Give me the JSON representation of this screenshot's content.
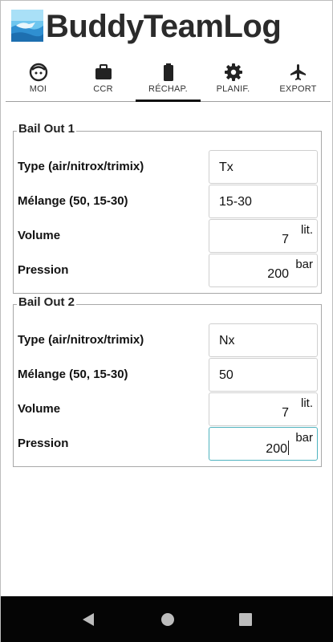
{
  "app": {
    "title": "BuddyTeamLog"
  },
  "tabs": [
    {
      "label": "MOI",
      "icon": "face-icon"
    },
    {
      "label": "CCR",
      "icon": "briefcase-icon"
    },
    {
      "label": "RÉCHAP.",
      "icon": "battery-icon",
      "active": true
    },
    {
      "label": "PLANIF.",
      "icon": "gear-icon"
    },
    {
      "label": "EXPORT",
      "icon": "airplane-icon"
    }
  ],
  "bailouts": [
    {
      "title": "Bail Out 1",
      "type_label": "Type (air/nitrox/trimix)",
      "type_value": "Tx",
      "mix_label": "Mélange (50, 15-30)",
      "mix_value": "15-30",
      "volume_label": "Volume",
      "volume_value": "7",
      "volume_unit": "lit.",
      "pressure_label": "Pression",
      "pressure_value": "200",
      "pressure_unit": "bar"
    },
    {
      "title": "Bail Out 2",
      "type_label": "Type (air/nitrox/trimix)",
      "type_value": "Nx",
      "mix_label": "Mélange (50, 15-30)",
      "mix_value": "50",
      "volume_label": "Volume",
      "volume_value": "7",
      "volume_unit": "lit.",
      "pressure_label": "Pression",
      "pressure_value": "200",
      "pressure_unit": "bar"
    }
  ],
  "navigation": {
    "back_icon": "back-triangle-icon",
    "home_icon": "home-circle-icon",
    "recents_icon": "recents-square-icon"
  },
  "colors": {
    "focus_border": "#4fb3bf",
    "nav_bar": "#050505",
    "title": "#2b2b2b"
  }
}
